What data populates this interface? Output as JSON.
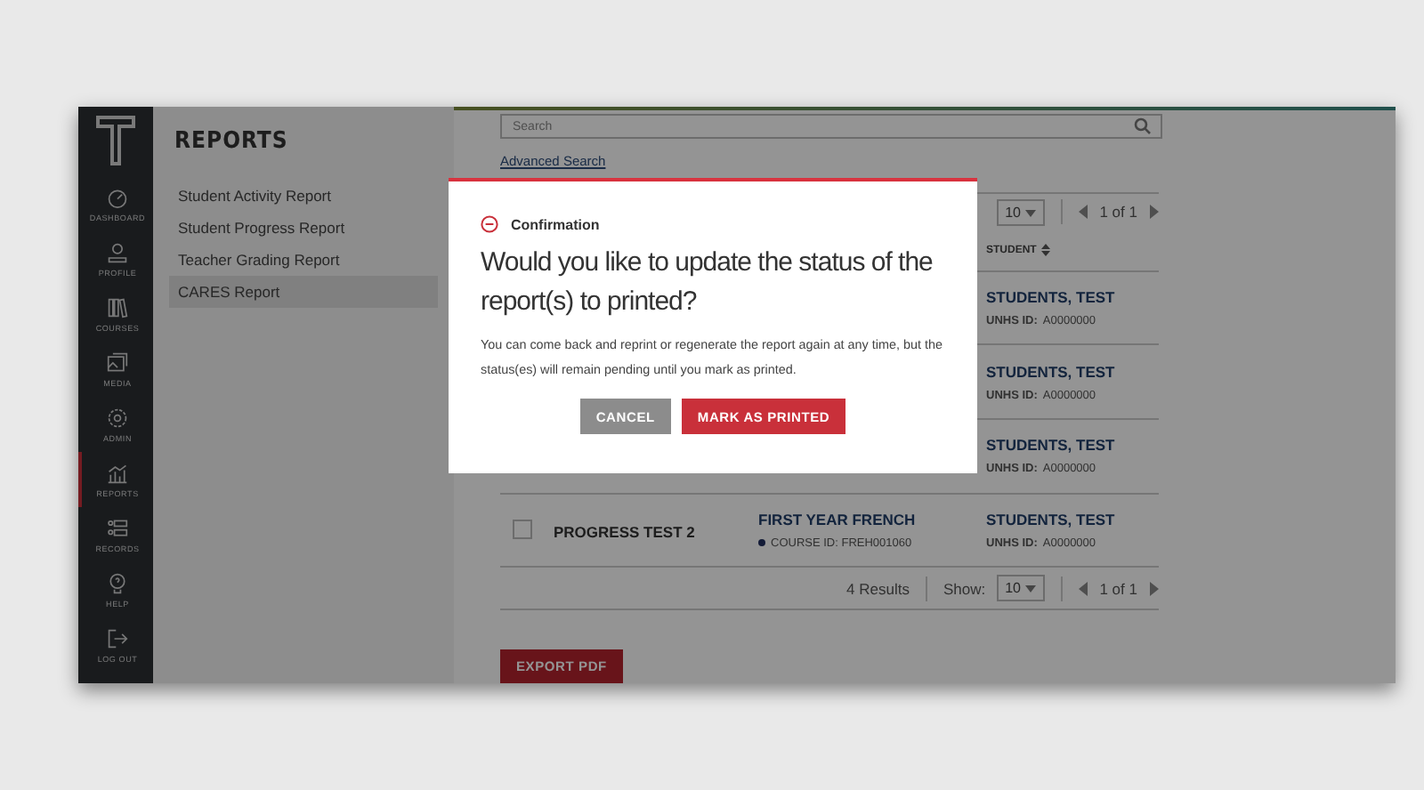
{
  "sidebar": {
    "items": [
      {
        "kind": "dashboard",
        "label": "DASHBOARD",
        "selected": false
      },
      {
        "kind": "profile",
        "label": "PROFILE",
        "selected": false
      },
      {
        "kind": "courses",
        "label": "COURSES",
        "selected": false
      },
      {
        "kind": "media",
        "label": "MEDIA",
        "selected": false
      },
      {
        "kind": "admin",
        "label": "ADMIN",
        "selected": false
      },
      {
        "kind": "reports",
        "label": "REPORTS",
        "selected": true
      },
      {
        "kind": "records",
        "label": "RECORDS",
        "selected": false
      },
      {
        "kind": "help",
        "label": "HELP",
        "selected": false
      },
      {
        "kind": "logout",
        "label": "LOG OUT",
        "selected": false
      }
    ]
  },
  "reports_panel": {
    "title": "REPORTS",
    "items": [
      {
        "label": "Student Activity Report",
        "selected": false
      },
      {
        "label": "Student Progress Report",
        "selected": false
      },
      {
        "label": "Teacher Grading Report",
        "selected": false
      },
      {
        "label": "CARES Report",
        "selected": true
      }
    ]
  },
  "search": {
    "placeholder": "Search"
  },
  "advanced_search": "Advanced Search",
  "top_pager": {
    "show_value": "10",
    "page": "1 of 1"
  },
  "table": {
    "columns": [
      "STUDENT"
    ],
    "rows": [
      {
        "checked": null,
        "name": "",
        "course": "",
        "course_id": "",
        "student": "STUDENTS, TEST",
        "student_id_label": "UNHS ID:",
        "student_id": "A0000000"
      },
      {
        "checked": null,
        "name": "",
        "course": "",
        "course_id": "",
        "student": "STUDENTS, TEST",
        "student_id_label": "UNHS ID:",
        "student_id": "A0000000"
      },
      {
        "checked": null,
        "name": "",
        "course": "",
        "course_id": "",
        "student": "STUDENTS, TEST",
        "student_id_label": "UNHS ID:",
        "student_id": "A0000000"
      },
      {
        "checked": false,
        "name": "PROGRESS TEST 2",
        "course": "FIRST YEAR FRENCH",
        "course_id": "COURSE ID: FREH001060",
        "student": "STUDENTS, TEST",
        "student_id_label": "UNHS ID:",
        "student_id": "A0000000"
      }
    ]
  },
  "footer": {
    "results": "4 Results",
    "show_label": "Show:",
    "show_value": "10",
    "page": "1 of 1"
  },
  "export_button": "EXPORT PDF",
  "modal": {
    "heading": "Confirmation",
    "question": "Would you like to update the status of the report(s) to printed?",
    "body": "You can come back and reprint or regenerate the report again at any time, but the status(es) will remain pending until you mark as printed.",
    "buttons": [
      {
        "kind": "secondary",
        "label": "CANCEL"
      },
      {
        "kind": "primary",
        "label": "MARK AS PRINTED"
      }
    ]
  }
}
